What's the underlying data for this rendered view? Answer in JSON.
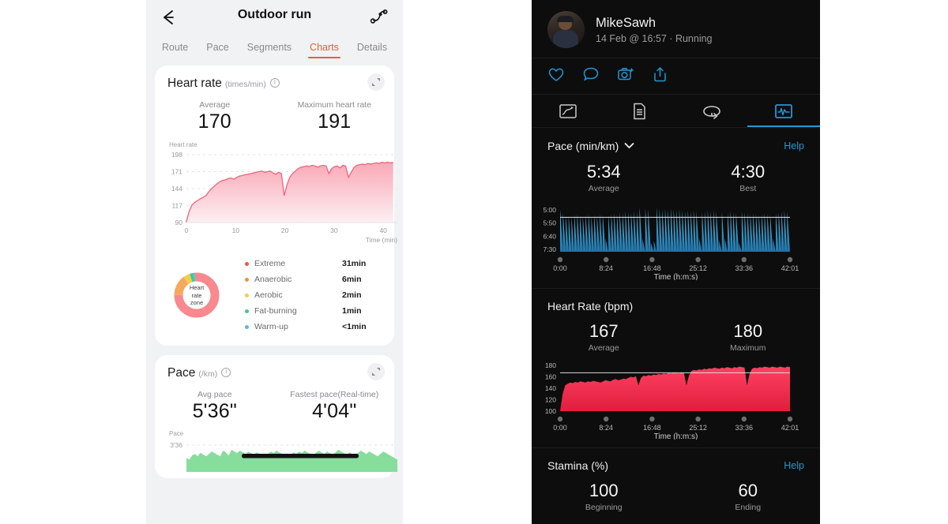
{
  "left_phone": {
    "topbar": {
      "back_icon": "back-arrow-icon",
      "title": "Outdoor run",
      "share_icon": "share-route-icon"
    },
    "tabs": [
      {
        "label": "Route",
        "active": false
      },
      {
        "label": "Pace",
        "active": false
      },
      {
        "label": "Segments",
        "active": false
      },
      {
        "label": "Charts",
        "active": true
      },
      {
        "label": "Details",
        "active": false
      }
    ],
    "accent_color": "#e8602c",
    "heart_rate_card": {
      "title": "Heart rate",
      "unit": "(times/min)",
      "info_icon": "info-icon",
      "expand_icon": "expand-icon",
      "stats": [
        {
          "label": "Average",
          "value": "170"
        },
        {
          "label": "Maximum heart rate",
          "value": "191"
        }
      ],
      "zones": [
        {
          "name": "Extreme",
          "value": "31min",
          "color": "#f4554a"
        },
        {
          "name": "Anaerobic",
          "value": "6min",
          "color": "#f0913f"
        },
        {
          "name": "Aerobic",
          "value": "2min",
          "color": "#f5cc4d"
        },
        {
          "name": "Fat-burning",
          "value": "1min",
          "color": "#3fce83"
        },
        {
          "name": "Warm-up",
          "value": "<1min",
          "color": "#5fb4f0"
        }
      ],
      "donut_label": "Heart\nrate\nzone"
    },
    "pace_card": {
      "title": "Pace",
      "unit": "(/km)",
      "info_icon": "info-icon",
      "expand_icon": "expand-icon",
      "stats": [
        {
          "label": "Avg pace",
          "value": "5'36\""
        },
        {
          "label": "Fastest pace(Real-time)",
          "value": "4'04\""
        }
      ]
    }
  },
  "right_phone": {
    "user": {
      "name": "MikeSawh",
      "meta": "14 Feb @ 16:57 · Running",
      "avatar": "user-avatar"
    },
    "actions": [
      {
        "icon": "heart-icon"
      },
      {
        "icon": "comment-icon"
      },
      {
        "icon": "camera-icon"
      },
      {
        "icon": "share-icon"
      }
    ],
    "tabs": [
      {
        "icon": "map-route-icon",
        "active": false
      },
      {
        "icon": "document-icon",
        "active": false
      },
      {
        "icon": "laps-loop-icon",
        "active": false
      },
      {
        "icon": "charts-icon",
        "active": true
      }
    ],
    "accent_color": "#2196d6",
    "sections": [
      {
        "title": "Pace (min/km)",
        "has_chevron": true,
        "help_label": "Help",
        "stats": [
          {
            "value": "5:34",
            "label": "Average"
          },
          {
            "value": "4:30",
            "label": "Best"
          }
        ]
      },
      {
        "title": "Heart Rate (bpm)",
        "has_chevron": false,
        "help_label": "",
        "stats": [
          {
            "value": "167",
            "label": "Average"
          },
          {
            "value": "180",
            "label": "Maximum"
          }
        ]
      },
      {
        "title": "Stamina (%)",
        "has_chevron": false,
        "help_label": "Help",
        "stats": [
          {
            "value": "100",
            "label": "Beginning"
          },
          {
            "value": "60",
            "label": "Ending"
          }
        ]
      }
    ]
  },
  "chart_data": [
    {
      "type": "area",
      "id": "left-heart-rate",
      "title": "Heart rate",
      "xlabel": "Time (min)",
      "ylabel": "Heart rate",
      "yticks": [
        198,
        171,
        144,
        117,
        90
      ],
      "ylim": [
        90,
        198
      ],
      "xticks": [
        0,
        10,
        20,
        30,
        40
      ],
      "xlim": [
        0,
        42
      ],
      "grid": true,
      "color": "#f2647a",
      "fill": "#fbd3da",
      "values": [
        92,
        108,
        118,
        122,
        125,
        128,
        130,
        133,
        139,
        144,
        148,
        152,
        155,
        157,
        158,
        160,
        161,
        159,
        162,
        164,
        165,
        166,
        167,
        168,
        169,
        170,
        171,
        172,
        170,
        171,
        172,
        169,
        167,
        170,
        168,
        133,
        150,
        162,
        168,
        172,
        176,
        178,
        179,
        180,
        179,
        181,
        180,
        178,
        180,
        181,
        180,
        168,
        176,
        179,
        180,
        177,
        181,
        180,
        162,
        170,
        178,
        181,
        182,
        183,
        182,
        184,
        183,
        184,
        185,
        184,
        186,
        185,
        186,
        185,
        186
      ]
    },
    {
      "type": "pie",
      "id": "heart-rate-zone-donut",
      "title": "Heart rate zone",
      "categories": [
        "Extreme",
        "Anaerobic",
        "Aerobic",
        "Fat-burning",
        "Warm-up"
      ],
      "values": [
        31,
        6,
        2,
        1,
        0.5
      ],
      "colors": [
        "#f9888f",
        "#f4a95f",
        "#f5cc4d",
        "#3fce83",
        "#5fb4f0"
      ],
      "units": "min"
    },
    {
      "type": "area",
      "id": "left-pace",
      "title": "Pace",
      "ylabel": "Pace",
      "yticks": [
        "3'36"
      ],
      "color": "#7fd99a",
      "values": [
        34,
        30,
        40,
        44,
        38,
        47,
        42,
        38,
        44,
        50,
        46,
        42,
        38,
        52,
        48,
        40,
        54,
        50,
        46,
        52,
        48,
        44,
        50,
        46,
        42,
        48,
        44,
        40,
        36,
        44,
        50,
        46,
        52,
        48,
        44,
        40,
        36,
        42,
        48,
        44,
        50,
        46,
        52,
        48,
        44,
        40,
        46,
        52,
        48,
        44,
        50,
        46,
        42,
        48,
        54,
        50,
        46,
        42,
        48,
        44,
        40,
        46,
        52,
        48,
        44,
        50,
        46,
        42,
        38,
        44,
        50,
        46,
        42,
        38,
        34,
        30
      ]
    },
    {
      "type": "area",
      "id": "right-pace",
      "title": "Pace (min/km)",
      "xlabel": "Time (h:m:s)",
      "yticks": [
        "5:00",
        "5:50",
        "6:40",
        "7:30"
      ],
      "xticks": [
        "0:00",
        "8:24",
        "16:48",
        "25:12",
        "33:36",
        "42:01"
      ],
      "average_line": "5:34",
      "color_top": "#59c1ea",
      "color_bottom": "#1f74ab",
      "values": [
        95,
        88,
        82,
        80,
        78,
        84,
        86,
        82,
        80,
        84,
        86,
        80,
        84,
        82,
        86,
        84,
        30,
        82,
        86,
        88,
        86,
        90,
        88,
        92,
        90,
        88,
        92,
        90,
        100,
        30,
        98,
        96,
        20,
        25,
        100,
        98,
        96,
        98,
        96,
        98,
        96,
        94,
        96,
        94,
        92,
        94,
        92,
        94,
        92,
        30,
        90,
        92,
        94,
        92,
        94,
        92,
        25,
        90,
        30,
        88,
        92,
        90,
        88,
        20,
        92,
        90,
        88,
        86,
        88,
        86,
        84,
        86,
        88,
        86,
        84,
        30,
        88,
        90,
        92,
        94,
        92,
        94
      ]
    },
    {
      "type": "area",
      "id": "right-heart-rate",
      "title": "Heart Rate (bpm)",
      "xlabel": "Time (h:m:s)",
      "yticks": [
        180,
        160,
        140,
        120,
        100
      ],
      "ylim": [
        100,
        180
      ],
      "xticks": [
        "0:00",
        "8:24",
        "16:48",
        "25:12",
        "33:36",
        "42:01"
      ],
      "average_line": 167,
      "color_top": "#f0395a",
      "color_bottom": "#e8243f",
      "values": [
        100,
        130,
        145,
        148,
        150,
        149,
        151,
        150,
        152,
        151,
        150,
        152,
        151,
        153,
        152,
        151,
        150,
        152,
        154,
        153,
        152,
        155,
        156,
        154,
        155,
        157,
        156,
        158,
        160,
        159,
        161,
        145,
        158,
        162,
        161,
        163,
        162,
        164,
        163,
        165,
        164,
        166,
        165,
        167,
        166,
        168,
        167,
        166,
        168,
        167,
        145,
        162,
        170,
        172,
        171,
        173,
        172,
        174,
        173,
        175,
        174,
        176,
        175,
        174,
        176,
        175,
        177,
        176,
        175,
        177,
        176,
        178,
        177,
        176,
        145,
        165,
        174,
        176,
        175,
        177,
        176,
        178,
        177,
        176,
        178,
        177,
        176,
        178,
        177,
        176,
        178,
        177
      ]
    }
  ]
}
